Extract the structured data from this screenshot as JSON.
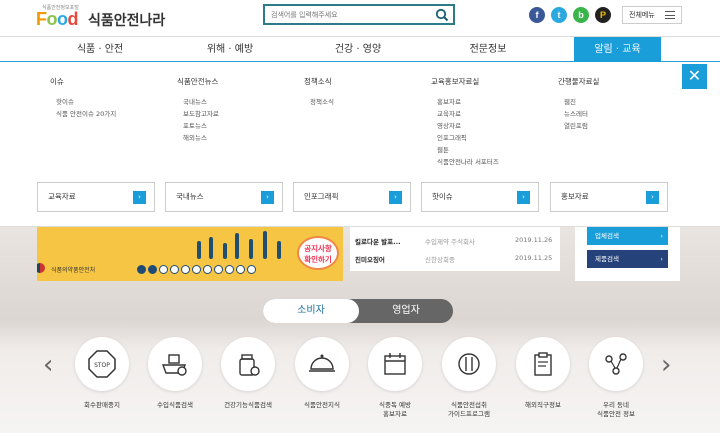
{
  "header": {
    "logo_small": "식품안전정보포털",
    "logo_food": [
      "F",
      "o",
      "o",
      "d"
    ],
    "logo_colors": [
      "#f39800",
      "#8bc34a",
      "#29a9e0",
      "#e64a3b"
    ],
    "logo_kor": "식품안전나라",
    "search_placeholder": "검색어를 입력해주세요",
    "sns": [
      {
        "name": "facebook",
        "glyph": "f",
        "color": "#3b5998"
      },
      {
        "name": "twitter",
        "glyph": "t",
        "color": "#2aa9e0"
      },
      {
        "name": "blog",
        "glyph": "b",
        "color": "#3ab54a"
      },
      {
        "name": "post",
        "glyph": "P",
        "color": "#222"
      }
    ],
    "all_menu": "전체메뉴"
  },
  "gnb": [
    "식품 · 안전",
    "위해 · 예방",
    "건강 · 영양",
    "전문정보",
    "알림 · 교육"
  ],
  "gnb_active_index": 4,
  "mega": {
    "columns": [
      {
        "title": "이슈",
        "items": [
          "핫이슈",
          "식품 안전이슈 20가지"
        ]
      },
      {
        "title": "식품안전뉴스",
        "items": [
          "국내뉴스",
          "보도참고자료",
          "포토뉴스",
          "해외뉴스"
        ]
      },
      {
        "title": "정책소식",
        "items": [
          "정책소식"
        ]
      },
      {
        "title": "교육홍보자료실",
        "items": [
          "홍보자료",
          "교육자료",
          "영상자료",
          "인포그래픽",
          "웹툰",
          "식품안전나라 서포터즈"
        ]
      },
      {
        "title": "간행물자료실",
        "items": [
          "웹진",
          "뉴스레터",
          "열린포럼"
        ]
      }
    ],
    "quick": [
      "교육자료",
      "국내뉴스",
      "인포그래픽",
      "핫이슈",
      "홍보자료"
    ],
    "close": "✕"
  },
  "banner": {
    "notice": [
      "공지사항",
      "확인하기"
    ],
    "org": "식품의약품안전처"
  },
  "news": [
    {
      "title": "킬로다운 발포...",
      "company": "수입제약 주식회사",
      "date": "2019.11.26"
    },
    {
      "title": "진미오징어",
      "company": "신한상회중",
      "date": "2019.11.25"
    }
  ],
  "side_buttons": [
    "업체검색",
    "제품검색"
  ],
  "toggle": {
    "on": "소비자",
    "off": "영업자"
  },
  "services": [
    "회수판매중지",
    "수입식품검색",
    "건강기능식품검색",
    "식품안전지식",
    "식중독 예방\n홍보자료",
    "식품안전섭취\n가이드프로그램",
    "해외직구정보",
    "우리 동네\n식품안전 정보"
  ],
  "nav": {
    "prev": "‹",
    "next": "›"
  }
}
